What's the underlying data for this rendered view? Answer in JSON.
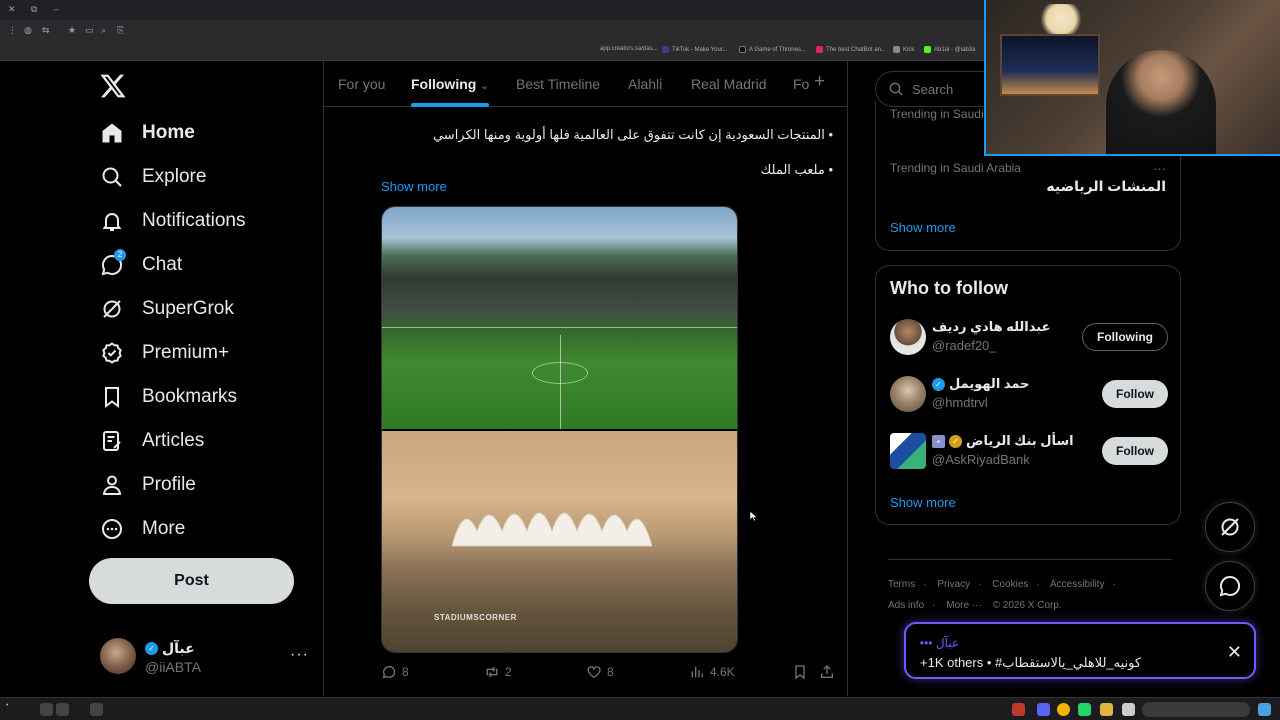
{
  "browser": {
    "bookmarks": [
      {
        "label": "app.creators.sa/das...",
        "color": "#3b82f6"
      },
      {
        "label": "TikTok - Make Your...",
        "color": "#111111"
      },
      {
        "label": "A Game of Thrones...",
        "color": "#222222"
      },
      {
        "label": "The best ChatBot an...",
        "color": "#e0245e"
      },
      {
        "label": "Kick",
        "color": "#53fc18"
      },
      {
        "label": "Ab1al - @iab3a",
        "color": "#555555"
      }
    ]
  },
  "nav": {
    "items": [
      {
        "name": "home",
        "label": "Home"
      },
      {
        "name": "explore",
        "label": "Explore"
      },
      {
        "name": "notifications",
        "label": "Notifications"
      },
      {
        "name": "chat",
        "label": "Chat",
        "badge": "2"
      },
      {
        "name": "supergrok",
        "label": "SuperGrok"
      },
      {
        "name": "premium",
        "label": "Premium+"
      },
      {
        "name": "bookmarks",
        "label": "Bookmarks"
      },
      {
        "name": "articles",
        "label": "Articles"
      },
      {
        "name": "profile",
        "label": "Profile"
      },
      {
        "name": "more",
        "label": "More"
      }
    ],
    "post_label": "Post",
    "profile": {
      "name": "عبآل",
      "handle": "@iiABTA",
      "more": "···"
    }
  },
  "tabs": [
    {
      "label": "For you",
      "active": false
    },
    {
      "label": "Following",
      "active": true
    },
    {
      "label": "Best Timeline",
      "active": false
    },
    {
      "label": "Alahli",
      "active": false
    },
    {
      "label": "Real Madrid",
      "active": false
    },
    {
      "label": "Fo",
      "active": false
    }
  ],
  "tweet": {
    "line1": "• المنتجات السعودية إن كانت تتفوق على العالمية فلها أولوية ومنها الكراسي",
    "line2": "• ملعب الملك",
    "show_more": "Show more",
    "watermark": "STADIUMSCORNER",
    "actions": {
      "replies": "8",
      "reposts": "2",
      "likes": "8",
      "views": "4.6K"
    }
  },
  "search": {
    "placeholder": "Search"
  },
  "trends": {
    "meta_top": "Trending in Saudi Arabia",
    "meta": "Trending in Saudi Arabia",
    "title": "المنشات الرياضيه",
    "more": "···",
    "show_more": "Show more"
  },
  "who_to_follow": {
    "title": "Who to follow",
    "users": [
      {
        "name": "عبدالله هادي رديف",
        "handle": "@radef20_",
        "button": "Following"
      },
      {
        "name": "حمد الهويمل",
        "handle": "@hmdtrvl",
        "button": "Follow"
      },
      {
        "name": "اسأل بنك الرياض",
        "handle": "@AskRiyadBank",
        "button": "Follow"
      }
    ],
    "show_more": "Show more"
  },
  "footer": {
    "line1": [
      "Terms",
      "·",
      "Privacy",
      "·",
      "Cookies",
      "·",
      "Accessibility",
      "·"
    ],
    "line2": [
      "Ads info",
      "·",
      "More ···",
      "© 2026 X Corp."
    ]
  },
  "toast": {
    "author": "عبآل •••",
    "text": "+1K others • #كونيه_للاهلي_يالاستقطاب"
  },
  "colors": {
    "accent": "#1d9bf0",
    "grok": "#7856ff",
    "gold": "#d4a017"
  }
}
